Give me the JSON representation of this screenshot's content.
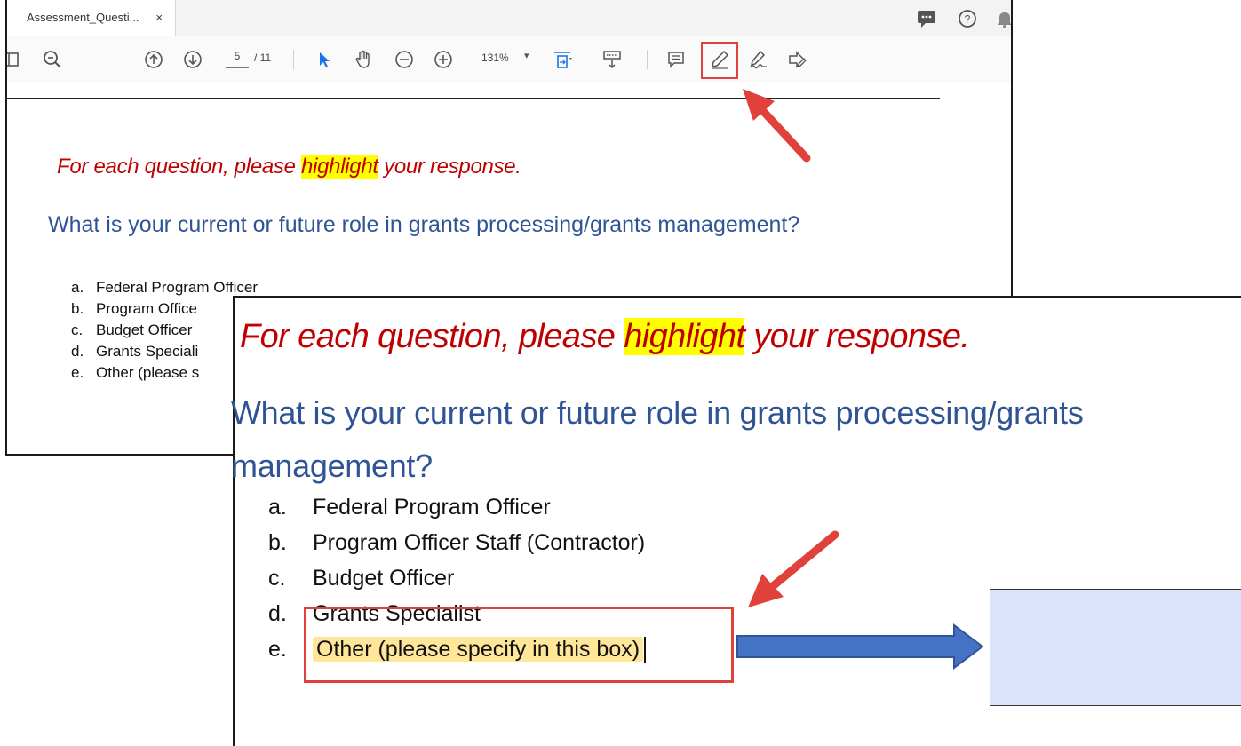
{
  "viewer": {
    "tab_title": "Assessment_Questi...",
    "tab_close": "×",
    "page_current": "5",
    "page_total": "/ 11",
    "zoom": "131%",
    "zoom_caret": "▾"
  },
  "document": {
    "instruction_before": "For each question, please ",
    "instruction_highlight": "highlight",
    "instruction_after": " your response.",
    "question": "What is your current or future role in grants processing/grants management?",
    "options": [
      {
        "letter": "a.",
        "text": "Federal Program Officer"
      },
      {
        "letter": "b.",
        "text": "Program Officer Staff (Contractor)"
      },
      {
        "letter": "c.",
        "text": "Budget Officer"
      },
      {
        "letter": "d.",
        "text": "Grants Specialist"
      },
      {
        "letter": "e.",
        "text": "Other (please specify in this box)"
      }
    ],
    "back_options_visible": [
      {
        "letter": "a.",
        "text": "Federal Program Officer"
      },
      {
        "letter": "b.",
        "text": "Program Office"
      },
      {
        "letter": "c.",
        "text": "Budget Officer"
      },
      {
        "letter": "d.",
        "text": "Grants Speciali"
      },
      {
        "letter": "e.",
        "text": "Other (please s"
      }
    ]
  },
  "colors": {
    "instruction_red": "#c00000",
    "question_blue": "#2f5496",
    "highlight_yellow": "#ffff00",
    "selection_yellow": "#ffe699",
    "callout_red": "#e0413a",
    "arrow_blue": "#4472c4",
    "specify_box_fill": "#dae3fb"
  },
  "icons": [
    "chat-icon",
    "help-icon",
    "bell-icon",
    "sidebar-toggle-icon",
    "zoom-search-icon",
    "page-up-icon",
    "page-down-icon",
    "select-pointer-icon",
    "hand-pan-icon",
    "zoom-out-icon",
    "zoom-in-icon",
    "fit-page-icon",
    "keyboard-scroll-icon",
    "comment-icon",
    "highlight-pen-icon",
    "sign-icon",
    "edit-fill-icon"
  ]
}
